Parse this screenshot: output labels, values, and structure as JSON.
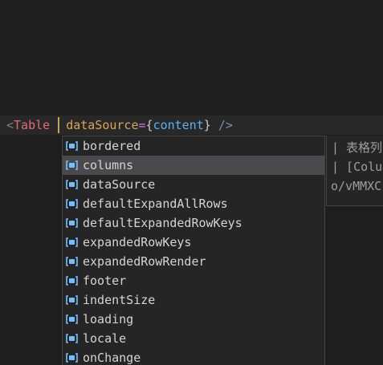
{
  "code": {
    "lt": "<",
    "tag": "Table",
    "attr": "dataSource",
    "eq": "=",
    "open_brace": "{",
    "value": "content",
    "close_brace": "}",
    "self_close": " />"
  },
  "suggestions": {
    "selected_index": 1,
    "icon": "property-icon",
    "items": [
      {
        "label": "bordered"
      },
      {
        "label": "columns"
      },
      {
        "label": "dataSource"
      },
      {
        "label": "defaultExpandAllRows"
      },
      {
        "label": "defaultExpandedRowKeys"
      },
      {
        "label": "expandedRowKeys"
      },
      {
        "label": "expandedRowRender"
      },
      {
        "label": "footer"
      },
      {
        "label": "indentSize"
      },
      {
        "label": "loading"
      },
      {
        "label": "locale"
      },
      {
        "label": "onChange"
      }
    ]
  },
  "details": {
    "line1": "| 表格列",
    "line2": "| [Colu",
    "line3": "o/vMMXC"
  },
  "colors": {
    "editor_bg": "#1e1e1e",
    "current_line": "#282828",
    "widget_bg": "#252526",
    "selected_bg": "#4a4a4c",
    "icon_blue": "#75beff",
    "tag": "#e06c75",
    "attr": "#d7a55e"
  }
}
